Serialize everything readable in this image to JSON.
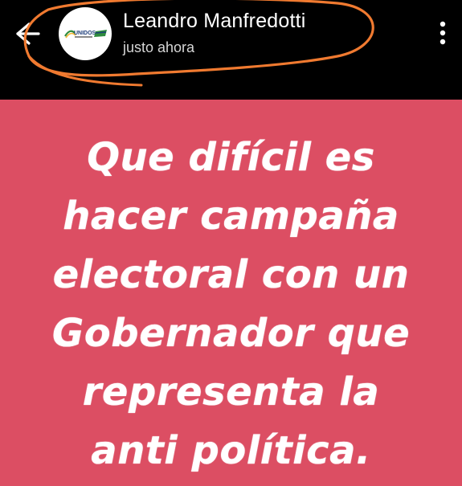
{
  "header": {
    "author_name": "Leandro Manfredotti",
    "post_time": "justo ahora",
    "avatar_text": "UNIDOS",
    "annotation_color": "#f07a30"
  },
  "post": {
    "background_color": "#dc4e63",
    "text_color": "#ffffff",
    "lines": [
      "Que difícil es",
      "hacer campaña",
      "electoral con un",
      "Gobernador que",
      "representa la",
      "anti política."
    ]
  },
  "icons": {
    "back": "back-arrow-icon",
    "more": "more-options-icon"
  }
}
